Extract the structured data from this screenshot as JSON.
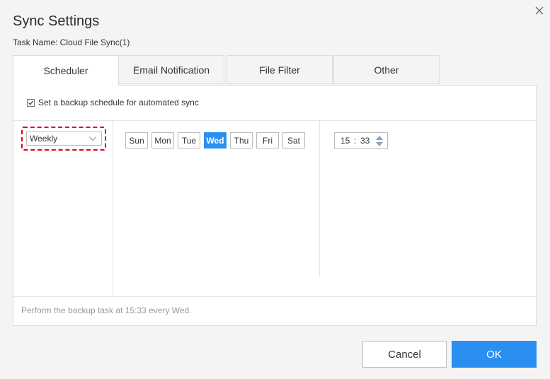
{
  "dialog": {
    "title": "Sync Settings",
    "task_name": "Task Name: Cloud File Sync(1)"
  },
  "tabs": [
    {
      "label": "Scheduler",
      "active": true
    },
    {
      "label": "Email Notification",
      "active": false
    },
    {
      "label": "File Filter",
      "active": false
    },
    {
      "label": "Other",
      "active": false
    }
  ],
  "scheduler": {
    "enable_label": "Set a backup schedule for automated sync",
    "enabled": true,
    "frequency": "Weekly",
    "days": [
      {
        "label": "Sun",
        "selected": false
      },
      {
        "label": "Mon",
        "selected": false
      },
      {
        "label": "Tue",
        "selected": false
      },
      {
        "label": "Wed",
        "selected": true
      },
      {
        "label": "Thu",
        "selected": false
      },
      {
        "label": "Fri",
        "selected": false
      },
      {
        "label": "Sat",
        "selected": false
      }
    ],
    "time": {
      "hour": "15",
      "separator": ":",
      "minute": "33"
    },
    "summary": "Perform the backup task at 15:33 every Wed."
  },
  "buttons": {
    "cancel": "Cancel",
    "ok": "OK"
  },
  "colors": {
    "accent": "#2b8ff2",
    "highlight_border": "#e0001b"
  }
}
